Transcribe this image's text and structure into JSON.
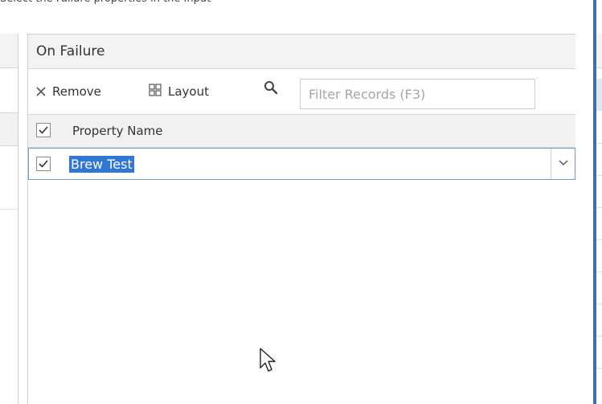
{
  "top_text": "Select the Failure properties in the Input",
  "panel": {
    "title": "On Failure",
    "toolbar": {
      "remove_label": "Remove",
      "layout_label": "Layout",
      "filter_placeholder": "Filter Records (F3)"
    },
    "grid": {
      "columns": [
        "Property Name"
      ],
      "rows": [
        {
          "checked": true,
          "property_name": "Brew Test",
          "selected": true
        }
      ]
    }
  },
  "icons": {
    "remove": "close-icon",
    "layout": "grid-icon",
    "search": "search-icon",
    "check": "check-icon",
    "dropdown": "chevron-down-icon",
    "cursor": "mouse-pointer-icon"
  },
  "colors": {
    "panel_header_bg": "#f3f3f3",
    "selection_bg": "#2f76d7",
    "row_border": "#6e9bd1",
    "accent_strip": "#3d6fa8"
  }
}
